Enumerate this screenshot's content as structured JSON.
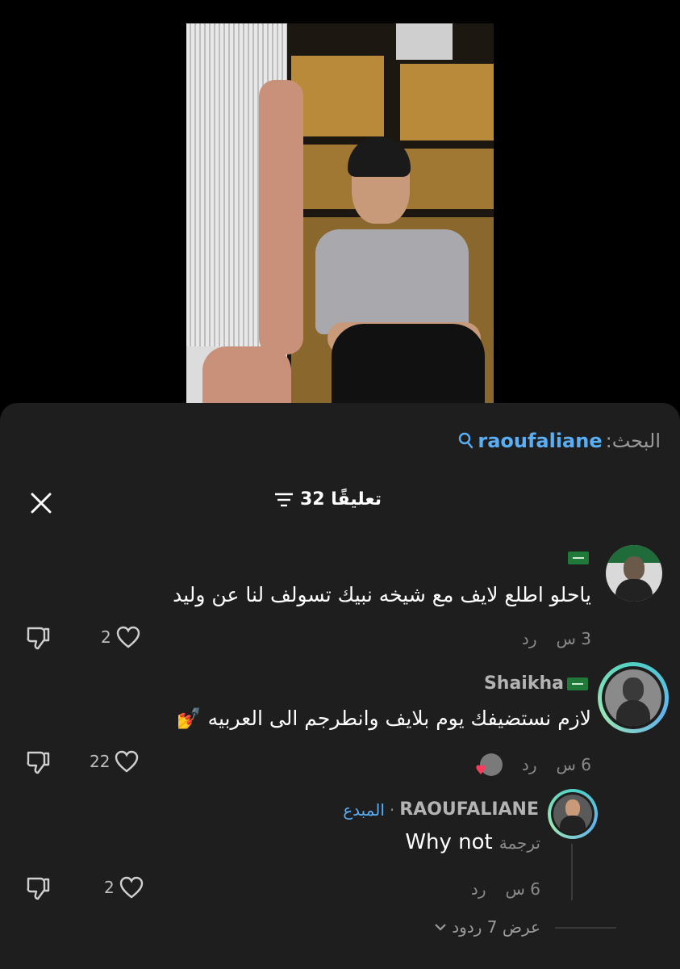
{
  "search": {
    "label": "البحث:",
    "query": "raoufaliane"
  },
  "comments_header": {
    "count_label": "32 تعليقًا"
  },
  "comments": [
    {
      "username": "",
      "flag": "saudi-flag",
      "text": "ياحلو اطلع لايف مع شيخه نبيك تسولف لنا عن وليد",
      "time": "3 س",
      "reply": "رد",
      "likes": "2"
    },
    {
      "username": "Shaikha",
      "flag": "saudi-flag",
      "text": "لازم نستضيفك يوم بلايف وانطرجم الى العربيه 💅",
      "time": "6 س",
      "reply": "رد",
      "likes": "22"
    }
  ],
  "reply": {
    "username": "RAOUFALIANE",
    "badge": "المبدع",
    "translate": "ترجمة",
    "text": "Why not",
    "time": "6 س",
    "reply": "رد",
    "likes": "2"
  },
  "view_replies": "عرض 7 ردود"
}
